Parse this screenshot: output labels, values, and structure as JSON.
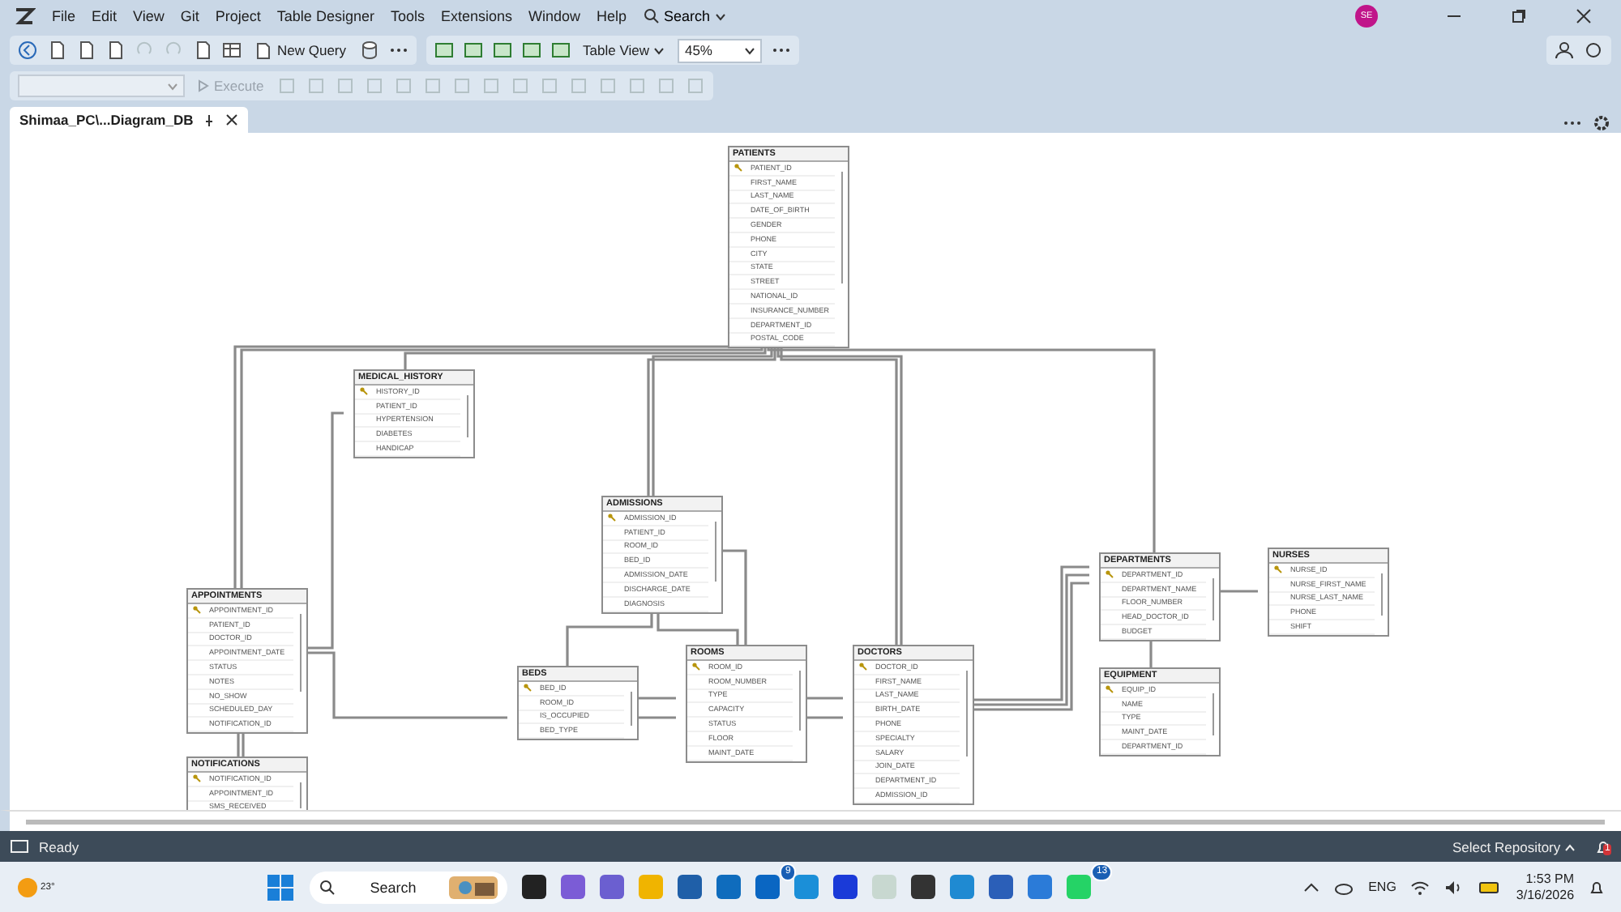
{
  "menu": {
    "items": [
      "File",
      "Edit",
      "View",
      "Git",
      "Project",
      "Table Designer",
      "Tools",
      "Extensions",
      "Window",
      "Help"
    ],
    "search": "Search"
  },
  "account": {
    "initials": "SE"
  },
  "toolbar": {
    "new_query": "New Query",
    "view": "Table View",
    "zoom": "45%"
  },
  "toolbar2": {
    "execute": {
      "label": "Execute",
      "disabled": true
    }
  },
  "tabs": [
    {
      "label": "Shimaa_PC\\...Diagram_DB",
      "selected": true
    }
  ],
  "diagram": {
    "tables": [
      {
        "name": "PATIENTS",
        "columns": [
          {
            "name": "PATIENT_ID",
            "key": true
          },
          {
            "name": "FIRST_NAME",
            "key": false
          },
          {
            "name": "LAST_NAME",
            "key": false
          },
          {
            "name": "DATE_OF_BIRTH",
            "key": false
          },
          {
            "name": "GENDER",
            "key": false
          },
          {
            "name": "PHONE",
            "key": false
          },
          {
            "name": "CITY",
            "key": false
          },
          {
            "name": "STATE",
            "key": false
          },
          {
            "name": "STREET",
            "key": false
          },
          {
            "name": "NATIONAL_ID",
            "key": false
          },
          {
            "name": "INSURANCE_NUMBER",
            "key": false
          },
          {
            "name": "DEPARTMENT_ID",
            "key": false
          },
          {
            "name": "POSTAL_CODE",
            "key": false
          }
        ]
      },
      {
        "name": "MEDICAL_HISTORY",
        "columns": [
          {
            "name": "HISTORY_ID",
            "key": true
          },
          {
            "name": "PATIENT_ID",
            "key": false
          },
          {
            "name": "HYPERTENSION",
            "key": false
          },
          {
            "name": "DIABETES",
            "key": false
          },
          {
            "name": "HANDICAP",
            "key": false
          }
        ]
      },
      {
        "name": "ADMISSIONS",
        "columns": [
          {
            "name": "ADMISSION_ID",
            "key": true
          },
          {
            "name": "PATIENT_ID",
            "key": false
          },
          {
            "name": "ROOM_ID",
            "key": false
          },
          {
            "name": "BED_ID",
            "key": false
          },
          {
            "name": "ADMISSION_DATE",
            "key": false
          },
          {
            "name": "DISCHARGE_DATE",
            "key": false
          },
          {
            "name": "DIAGNOSIS",
            "key": false
          }
        ]
      },
      {
        "name": "APPOINTMENTS",
        "columns": [
          {
            "name": "APPOINTMENT_ID",
            "key": true
          },
          {
            "name": "PATIENT_ID",
            "key": false
          },
          {
            "name": "DOCTOR_ID",
            "key": false
          },
          {
            "name": "APPOINTMENT_DATE",
            "key": false
          },
          {
            "name": "STATUS",
            "key": false
          },
          {
            "name": "NOTES",
            "key": false
          },
          {
            "name": "NO_SHOW",
            "key": false
          },
          {
            "name": "SCHEDULED_DAY",
            "key": false
          },
          {
            "name": "NOTIFICATION_ID",
            "key": false
          }
        ]
      },
      {
        "name": "DEPARTMENTS",
        "columns": [
          {
            "name": "DEPARTMENT_ID",
            "key": true
          },
          {
            "name": "DEPARTMENT_NAME",
            "key": false
          },
          {
            "name": "FLOOR_NUMBER",
            "key": false
          },
          {
            "name": "HEAD_DOCTOR_ID",
            "key": false
          },
          {
            "name": "BUDGET",
            "key": false
          }
        ]
      },
      {
        "name": "NURSES",
        "columns": [
          {
            "name": "NURSE_ID",
            "key": true
          },
          {
            "name": "NURSE_FIRST_NAME",
            "key": false
          },
          {
            "name": "NURSE_LAST_NAME",
            "key": false
          },
          {
            "name": "PHONE",
            "key": false
          },
          {
            "name": "SHIFT",
            "key": false
          }
        ]
      },
      {
        "name": "BEDS",
        "columns": [
          {
            "name": "BED_ID",
            "key": true
          },
          {
            "name": "ROOM_ID",
            "key": false
          },
          {
            "name": "IS_OCCUPIED",
            "key": false
          },
          {
            "name": "BED_TYPE",
            "key": false
          }
        ]
      },
      {
        "name": "ROOMS",
        "columns": [
          {
            "name": "ROOM_ID",
            "key": true
          },
          {
            "name": "ROOM_NUMBER",
            "key": false
          },
          {
            "name": "TYPE",
            "key": false
          },
          {
            "name": "CAPACITY",
            "key": false
          },
          {
            "name": "STATUS",
            "key": false
          },
          {
            "name": "FLOOR",
            "key": false
          },
          {
            "name": "MAINT_DATE",
            "key": false
          }
        ]
      },
      {
        "name": "DOCTORS",
        "columns": [
          {
            "name": "DOCTOR_ID",
            "key": true
          },
          {
            "name": "FIRST_NAME",
            "key": false
          },
          {
            "name": "LAST_NAME",
            "key": false
          },
          {
            "name": "BIRTH_DATE",
            "key": false
          },
          {
            "name": "PHONE",
            "key": false
          },
          {
            "name": "SPECIALTY",
            "key": false
          },
          {
            "name": "SALARY",
            "key": false
          },
          {
            "name": "JOIN_DATE",
            "key": false
          },
          {
            "name": "DEPARTMENT_ID",
            "key": false
          },
          {
            "name": "ADMISSION_ID",
            "key": false
          }
        ]
      },
      {
        "name": "EQUIPMENT",
        "columns": [
          {
            "name": "EQUIP_ID",
            "key": true
          },
          {
            "name": "NAME",
            "key": false
          },
          {
            "name": "TYPE",
            "key": false
          },
          {
            "name": "MAINT_DATE",
            "key": false
          },
          {
            "name": "DEPARTMENT_ID",
            "key": false
          }
        ]
      },
      {
        "name": "NOTIFICATIONS",
        "columns": [
          {
            "name": "NOTIFICATION_ID",
            "key": true
          },
          {
            "name": "APPOINTMENT_ID",
            "key": false
          },
          {
            "name": "SMS_RECEIVED",
            "key": false
          }
        ]
      }
    ]
  },
  "status_bar": {
    "text": "Ready",
    "repository": "Select Repository",
    "notifications": "1"
  },
  "taskbar": {
    "weather": "23°",
    "search": "Search",
    "app_badges": [
      "9",
      "13"
    ],
    "language": "ENG",
    "time": "1:53 PM",
    "date": "3/16/2026"
  }
}
